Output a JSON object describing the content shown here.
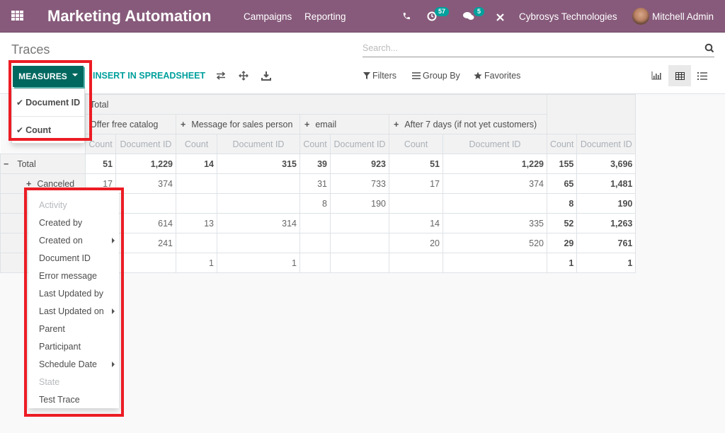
{
  "navbar": {
    "app_title": "Marketing Automation",
    "menu": [
      "Campaigns",
      "Reporting"
    ],
    "activity_badge": "57",
    "messages_badge": "5",
    "company": "Cybrosys Technologies",
    "user": "Mitchell Admin",
    "brand_color": "#875a7b"
  },
  "control_panel": {
    "breadcrumb": "Traces",
    "search_placeholder": "Search...",
    "measures_label": "MEASURES",
    "spreadsheet_label": "INSERT IN SPREADSHEET",
    "filters_label": "Filters",
    "groupby_label": "Group By",
    "favorites_label": "Favorites",
    "active_view": "pivot",
    "accent_color": "#00a09d"
  },
  "measures_dropdown": {
    "items": [
      {
        "label": "Document ID",
        "checked": true
      },
      {
        "label": "Count",
        "checked": true
      }
    ]
  },
  "groupby_dropdown": {
    "items": [
      {
        "label": "Activity",
        "disabled": true,
        "submenu": false
      },
      {
        "label": "Created by",
        "disabled": false,
        "submenu": false
      },
      {
        "label": "Created on",
        "disabled": false,
        "submenu": true
      },
      {
        "label": "Document ID",
        "disabled": false,
        "submenu": false
      },
      {
        "label": "Error message",
        "disabled": false,
        "submenu": false
      },
      {
        "label": "Last Updated by",
        "disabled": false,
        "submenu": false
      },
      {
        "label": "Last Updated on",
        "disabled": false,
        "submenu": true
      },
      {
        "label": "Parent",
        "disabled": false,
        "submenu": false
      },
      {
        "label": "Participant",
        "disabled": false,
        "submenu": false
      },
      {
        "label": "Schedule Date",
        "disabled": false,
        "submenu": true
      },
      {
        "label": "State",
        "disabled": true,
        "submenu": false
      },
      {
        "label": "Test Trace",
        "disabled": false,
        "submenu": false
      }
    ]
  },
  "pivot": {
    "top_header": "Total",
    "col_groups": [
      {
        "label": "Offer free catalog",
        "expandable": false
      },
      {
        "label": "Message for sales person",
        "expandable": true
      },
      {
        "label": "email",
        "expandable": true
      },
      {
        "label": "After 7 days (if not yet customers)",
        "expandable": true
      }
    ],
    "measures": [
      "Count",
      "Document ID"
    ],
    "rows": [
      {
        "label": "Total",
        "type": "grand",
        "values": [
          "51",
          "1,229",
          "14",
          "315",
          "39",
          "923",
          "51",
          "1,229"
        ],
        "totals": [
          "155",
          "3,696"
        ]
      },
      {
        "label": "Canceled",
        "type": "sub",
        "values": [
          "17",
          "374",
          "",
          "",
          "31",
          "733",
          "17",
          "374"
        ],
        "totals": [
          "65",
          "1,481"
        ]
      },
      {
        "label": "",
        "type": "sub",
        "values": [
          "",
          "",
          "",
          "",
          "8",
          "190",
          "",
          ""
        ],
        "totals": [
          "8",
          "190"
        ]
      },
      {
        "label": "",
        "type": "sub",
        "values": [
          "",
          "614",
          "13",
          "314",
          "",
          "",
          "14",
          "335"
        ],
        "totals": [
          "52",
          "1,263"
        ]
      },
      {
        "label": "",
        "type": "sub",
        "values": [
          "",
          "241",
          "",
          "",
          "",
          "",
          "20",
          "520"
        ],
        "totals": [
          "29",
          "761"
        ]
      },
      {
        "label": "",
        "type": "sub",
        "values": [
          "",
          "",
          "1",
          "1",
          "",
          "",
          "",
          ""
        ],
        "totals": [
          "1",
          "1"
        ]
      }
    ]
  }
}
